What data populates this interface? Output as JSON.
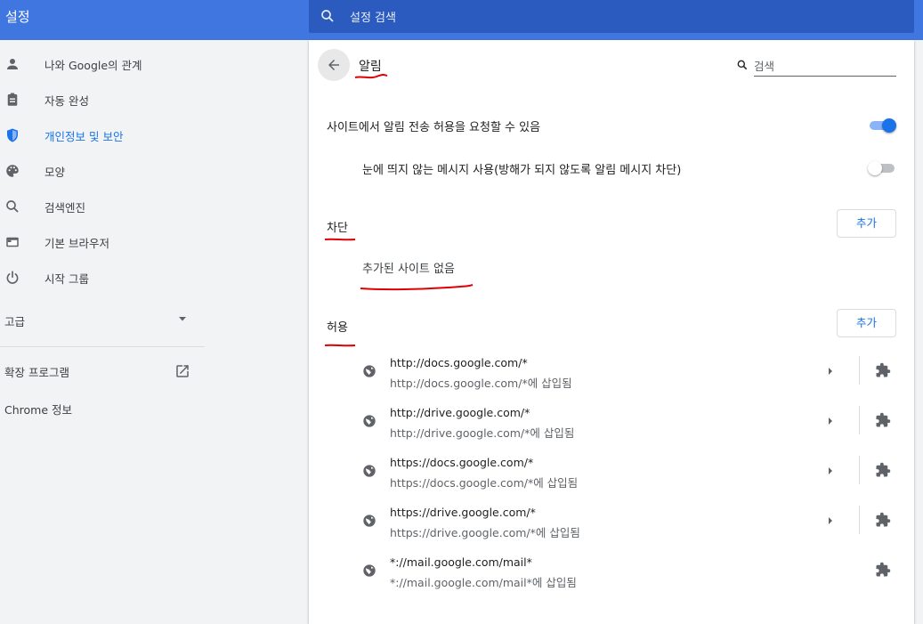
{
  "header": {
    "app_title": "설정",
    "search_placeholder": "설정 검색",
    "bar_color": "#4076e0",
    "search_color": "#2c5bbf"
  },
  "sidebar": {
    "items": [
      {
        "label": "나와 Google의 관계",
        "icon": "person-icon",
        "active": false
      },
      {
        "label": "자동 완성",
        "icon": "clipboard-icon",
        "active": false
      },
      {
        "label": "개인정보 및 보안",
        "icon": "shield-icon",
        "active": true
      },
      {
        "label": "모양",
        "icon": "palette-icon",
        "active": false
      },
      {
        "label": "검색엔진",
        "icon": "search-icon",
        "active": false
      },
      {
        "label": "기본 브라우저",
        "icon": "browser-icon",
        "active": false
      },
      {
        "label": "시작 그룹",
        "icon": "power-icon",
        "active": false
      }
    ],
    "advanced_label": "고급",
    "extensions_label": "확장 프로그램",
    "about_label": "Chrome 정보"
  },
  "page": {
    "title": "알림",
    "search_placeholder": "검색",
    "ask_label": "사이트에서 알림 전송 허용을 요청할 수 있음",
    "ask_enabled": true,
    "quiet_label": "눈에 띄지 않는 메시지 사용(방해가 되지 않도록 알림 메시지 차단)",
    "quiet_enabled": false,
    "block": {
      "heading": "차단",
      "add_label": "추가",
      "empty_text": "추가된 사이트 없음"
    },
    "allow": {
      "heading": "허용",
      "add_label": "추가",
      "sites": [
        {
          "url": "http://docs.google.com/*",
          "note": "http://docs.google.com/*에 삽입됨",
          "has_arrow": true
        },
        {
          "url": "http://drive.google.com/*",
          "note": "http://drive.google.com/*에 삽입됨",
          "has_arrow": true
        },
        {
          "url": "https://docs.google.com/*",
          "note": "https://docs.google.com/*에 삽입됨",
          "has_arrow": true
        },
        {
          "url": "https://drive.google.com/*",
          "note": "https://drive.google.com/*에 삽입됨",
          "has_arrow": true
        },
        {
          "url": "*://mail.google.com/mail*",
          "note": "*://mail.google.com/mail*에 삽입됨",
          "has_arrow": false
        }
      ]
    }
  },
  "colors": {
    "accent": "#1a73e8",
    "annotation": "#e00000"
  }
}
